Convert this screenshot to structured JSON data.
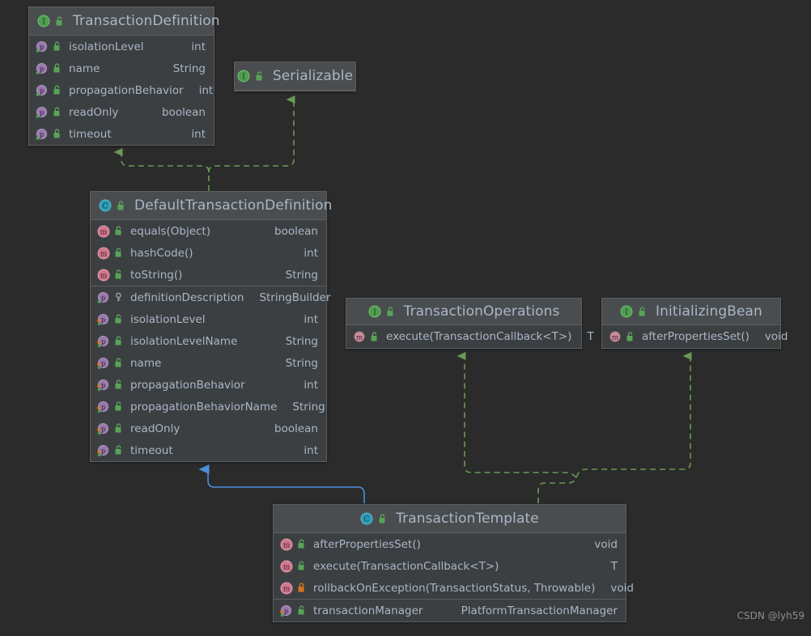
{
  "diagram": {
    "type": "uml-class-diagram",
    "background": "#2b2b2b",
    "watermark": "CSDN @lyh59",
    "colors": {
      "box_body": "#3c3f41",
      "box_header": "#4a4d4f",
      "box_border": "#5c5f61",
      "text": "#a9b7c6",
      "interface_icon": "#4f9e4f",
      "class_icon": "#2d9bb5",
      "method_icon": "#d0788f",
      "property_icon": "#9876aa",
      "inheritance_edge": "#6a9955",
      "association_edge": "#4a90d9"
    }
  },
  "classes": {
    "transaction_definition": {
      "name": "TransactionDefinition",
      "stereotype": "interface",
      "icon": "interface-icon",
      "visibility_icon": "public-lock-icon",
      "sections": [
        {
          "kind": "properties",
          "rows": [
            {
              "icon": "property-icon",
              "modifier_icon": "public-lock-icon",
              "name": "isolationLevel",
              "type": "int"
            },
            {
              "icon": "property-icon",
              "modifier_icon": "public-lock-icon",
              "name": "name",
              "type": "String"
            },
            {
              "icon": "property-icon",
              "modifier_icon": "public-lock-icon",
              "name": "propagationBehavior",
              "type": "int"
            },
            {
              "icon": "property-icon",
              "modifier_icon": "public-lock-icon",
              "name": "readOnly",
              "type": "boolean"
            },
            {
              "icon": "property-icon",
              "modifier_icon": "public-lock-icon",
              "name": "timeout",
              "type": "int"
            }
          ]
        }
      ]
    },
    "serializable": {
      "name": "Serializable",
      "stereotype": "interface",
      "icon": "interface-icon",
      "visibility_icon": "public-lock-icon",
      "sections": []
    },
    "default_transaction_definition": {
      "name": "DefaultTransactionDefinition",
      "stereotype": "class",
      "icon": "class-icon",
      "visibility_icon": "public-lock-icon",
      "sections": [
        {
          "kind": "methods",
          "rows": [
            {
              "icon": "method-icon",
              "modifier_icon": "public-lock-icon",
              "name": "equals(Object)",
              "type": "boolean"
            },
            {
              "icon": "method-icon",
              "modifier_icon": "public-lock-icon",
              "name": "hashCode()",
              "type": "int"
            },
            {
              "icon": "method-icon",
              "modifier_icon": "public-lock-icon",
              "name": "toString()",
              "type": "String"
            }
          ]
        },
        {
          "kind": "properties",
          "rows": [
            {
              "icon": "property-final-icon",
              "modifier_icon": "key-icon",
              "name": "definitionDescription",
              "type": "StringBuilder"
            },
            {
              "icon": "property-rw-icon",
              "modifier_icon": "public-lock-icon",
              "name": "isolationLevel",
              "type": "int"
            },
            {
              "icon": "property-rw-icon",
              "modifier_icon": "public-lock-icon",
              "name": "isolationLevelName",
              "type": "String"
            },
            {
              "icon": "property-rw-icon",
              "modifier_icon": "public-lock-icon",
              "name": "name",
              "type": "String"
            },
            {
              "icon": "property-rw-icon",
              "modifier_icon": "public-lock-icon",
              "name": "propagationBehavior",
              "type": "int"
            },
            {
              "icon": "property-rw-icon",
              "modifier_icon": "public-lock-icon",
              "name": "propagationBehaviorName",
              "type": "String"
            },
            {
              "icon": "property-rw-icon",
              "modifier_icon": "public-lock-icon",
              "name": "readOnly",
              "type": "boolean"
            },
            {
              "icon": "property-rw-icon",
              "modifier_icon": "public-lock-icon",
              "name": "timeout",
              "type": "int"
            }
          ]
        }
      ]
    },
    "transaction_operations": {
      "name": "TransactionOperations",
      "stereotype": "interface",
      "icon": "interface-icon",
      "visibility_icon": "public-lock-icon",
      "sections": [
        {
          "kind": "methods",
          "rows": [
            {
              "icon": "abstract-method-icon",
              "modifier_icon": "public-lock-icon",
              "name": "execute(TransactionCallback<T>)",
              "type": "T"
            }
          ]
        }
      ]
    },
    "initializing_bean": {
      "name": "InitializingBean",
      "stereotype": "interface",
      "icon": "interface-icon",
      "visibility_icon": "public-lock-icon",
      "sections": [
        {
          "kind": "methods",
          "rows": [
            {
              "icon": "abstract-method-icon",
              "modifier_icon": "public-lock-icon",
              "name": "afterPropertiesSet()",
              "type": "void"
            }
          ]
        }
      ]
    },
    "transaction_template": {
      "name": "TransactionTemplate",
      "stereotype": "class",
      "icon": "class-icon",
      "visibility_icon": "public-lock-icon",
      "sections": [
        {
          "kind": "methods",
          "rows": [
            {
              "icon": "method-icon",
              "modifier_icon": "public-lock-icon",
              "name": "afterPropertiesSet()",
              "type": "void"
            },
            {
              "icon": "method-icon",
              "modifier_icon": "public-lock-icon",
              "name": "execute(TransactionCallback<T>)",
              "type": "T"
            },
            {
              "icon": "method-icon",
              "modifier_icon": "protected-lock-icon",
              "name": "rollbackOnException(TransactionStatus, Throwable)",
              "type": "void"
            }
          ]
        },
        {
          "kind": "properties",
          "rows": [
            {
              "icon": "property-rw-icon",
              "modifier_icon": "public-lock-icon",
              "name": "transactionManager",
              "type": "PlatformTransactionManager"
            }
          ]
        }
      ]
    }
  },
  "relations": [
    {
      "from": "default_transaction_definition",
      "to": "transaction_definition",
      "kind": "implements",
      "style": "dashed",
      "color": "#6a9955"
    },
    {
      "from": "default_transaction_definition",
      "to": "serializable",
      "kind": "implements",
      "style": "dashed",
      "color": "#6a9955"
    },
    {
      "from": "transaction_template",
      "to": "transaction_operations",
      "kind": "implements",
      "style": "dashed",
      "color": "#6a9955"
    },
    {
      "from": "transaction_template",
      "to": "initializing_bean",
      "kind": "implements",
      "style": "dashed",
      "color": "#6a9955"
    },
    {
      "from": "transaction_template",
      "to": "default_transaction_definition",
      "kind": "extends",
      "style": "solid",
      "color": "#4a90d9"
    }
  ]
}
